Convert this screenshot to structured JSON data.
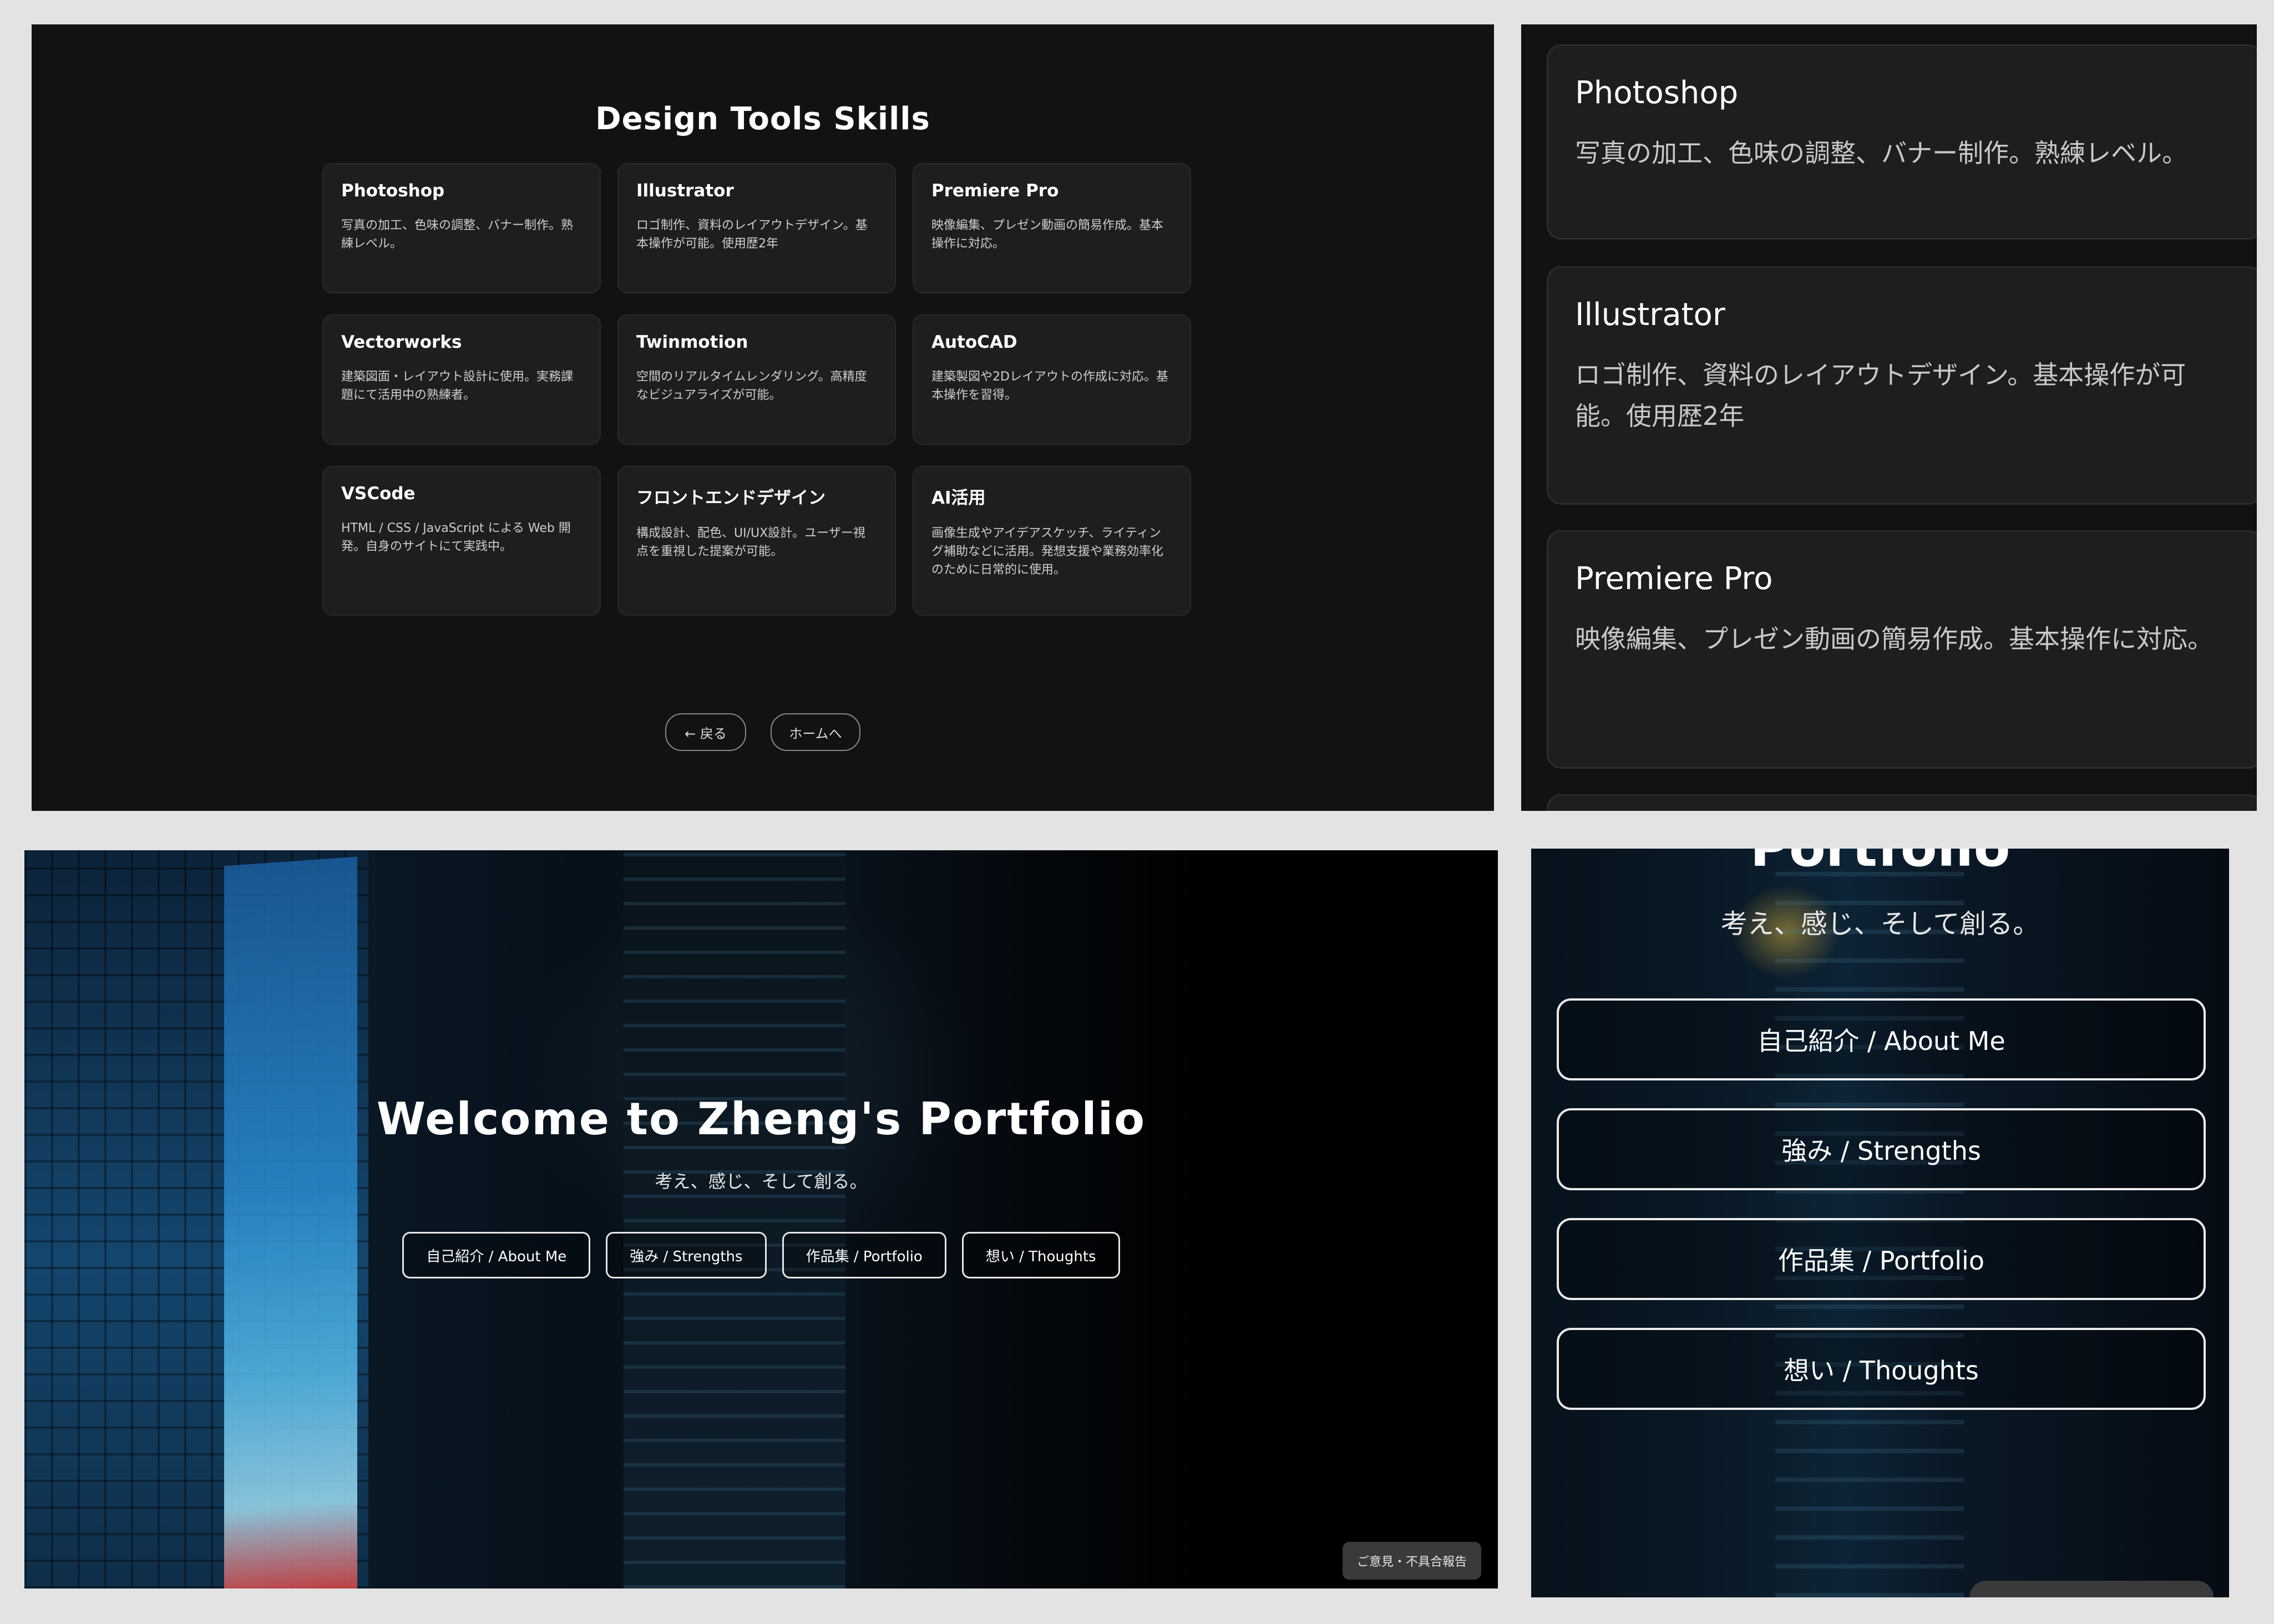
{
  "skills_page": {
    "title": "Design Tools Skills",
    "cards": [
      {
        "name": "Photoshop",
        "desc": "写真の加工、色味の調整、バナー制作。熟練レベル。"
      },
      {
        "name": "Illustrator",
        "desc": "ロゴ制作、資料のレイアウトデザイン。基本操作が可能。使用歴2年"
      },
      {
        "name": "Premiere Pro",
        "desc": "映像編集、プレゼン動画の簡易作成。基本操作に対応。"
      },
      {
        "name": "Vectorworks",
        "desc": "建築図面・レイアウト設計に使用。実務課題にて活用中の熟練者。"
      },
      {
        "name": "Twinmotion",
        "desc": "空間のリアルタイムレンダリング。高精度なビジュアライズが可能。"
      },
      {
        "name": "AutoCAD",
        "desc": "建築製図や2Dレイアウトの作成に対応。基本操作を習得。"
      },
      {
        "name": "VSCode",
        "desc": "HTML / CSS / JavaScript による Web 開発。自身のサイトにて実践中。"
      },
      {
        "name": "フロントエンドデザイン",
        "desc": "構成設計、配色、UI/UX設計。ユーザー視点を重視した提案が可能。"
      },
      {
        "name": "AI活用",
        "desc": "画像生成やアイデアスケッチ、ライティング補助などに活用。発想支援や業務効率化のために日常的に使用。"
      }
    ],
    "back_label": "← 戻る",
    "home_label": "ホームへ"
  },
  "zoom_cards": [
    {
      "name": "Photoshop",
      "desc": "写真の加工、色味の調整、バナー制作。熟練レベル。"
    },
    {
      "name": "Illustrator",
      "desc": "ロゴ制作、資料のレイアウトデザイン。基本操作が可能。使用歴2年"
    },
    {
      "name": "Premiere Pro",
      "desc": "映像編集、プレゼン動画の簡易作成。基本操作に対応。"
    }
  ],
  "hero": {
    "title": "Welcome to Zheng's Portfolio",
    "subtitle": "考え、感じ、そして創る。",
    "buttons": [
      "自己紹介 / About Me",
      "強み / Strengths",
      "作品集 / Portfolio",
      "想い / Thoughts"
    ],
    "feedback_label": "ご意見・不具合報告"
  },
  "mobile": {
    "cut_title": "Portfolio",
    "subtitle": "考え、感じ、そして創る。",
    "buttons": [
      "自己紹介 / About Me",
      "強み / Strengths",
      "作品集 / Portfolio",
      "想い / Thoughts"
    ]
  }
}
